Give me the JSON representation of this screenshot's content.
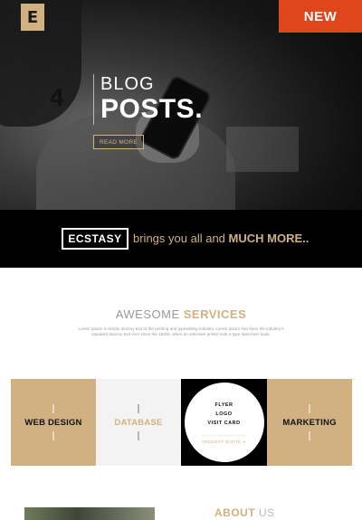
{
  "hero": {
    "logo_letter": "E",
    "badge": "NEW",
    "post_count": "4",
    "heading_line1": "BLOG",
    "heading_line2": "POSTS.",
    "button": "READ MORE"
  },
  "banner": {
    "brand": "ECSTASY",
    "tagline_prefix": "brings you all and",
    "tagline_emphasis": "MUCH MORE.."
  },
  "services": {
    "title_light": "AWESOME",
    "title_bold": "SERVICES",
    "description": "Lorem Ipsum is simply dummy text of the printing and typesetting industry. Lorem Ipsum has been the industry's standard dummy text ever since the 1500s, when an unknown printer took a type specimen book.",
    "tiles": [
      {
        "label": "WEB DESIGN"
      },
      {
        "label": "DATABASE"
      },
      {
        "lines": [
          "FLYER",
          "LOGO",
          "VISIT CARD"
        ],
        "link": "REQUEST QUOTE ➜"
      },
      {
        "label": "MARKETING"
      }
    ]
  },
  "about": {
    "title_a": "ABOUT",
    "title_b": "US"
  },
  "colors": {
    "accent": "#d1b182",
    "badge": "#e0461b",
    "dark": "#000000"
  }
}
